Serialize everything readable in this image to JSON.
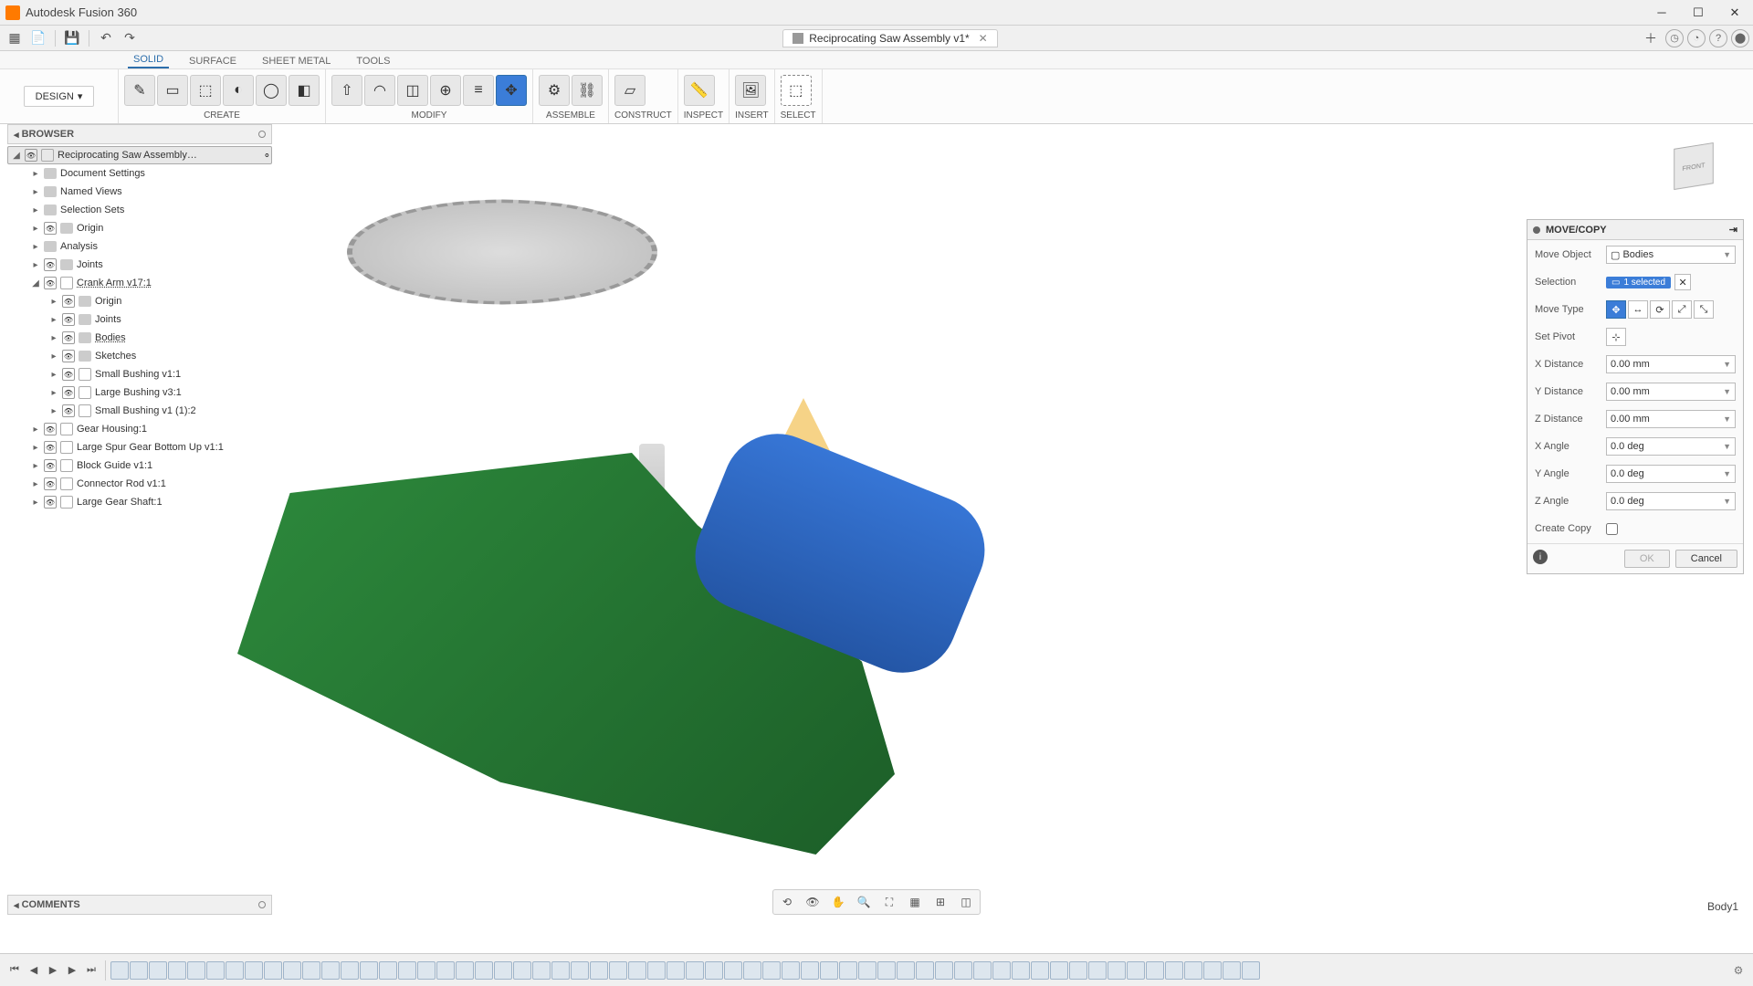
{
  "app": {
    "title": "Autodesk Fusion 360"
  },
  "doc": {
    "tab": "Reciprocating Saw Assembly v1*"
  },
  "workspace": {
    "label": "DESIGN"
  },
  "ribbontabs": [
    "SOLID",
    "SURFACE",
    "SHEET METAL",
    "TOOLS"
  ],
  "ribbon_active_tab": "SOLID",
  "ribbon_groups": [
    "CREATE",
    "MODIFY",
    "ASSEMBLE",
    "CONSTRUCT",
    "INSPECT",
    "INSERT",
    "SELECT"
  ],
  "browser": {
    "title": "BROWSER",
    "root": "Reciprocating Saw Assembly…",
    "items": [
      "Document Settings",
      "Named Views",
      "Selection Sets",
      "Origin",
      "Analysis",
      "Joints"
    ],
    "crank": {
      "name": "Crank Arm v17:1",
      "children": [
        "Origin",
        "Joints",
        "Bodies",
        "Sketches",
        "Small Bushing v1:1",
        "Large Bushing v3:1",
        "Small Bushing v1 (1):2"
      ]
    },
    "rest": [
      "Gear Housing:1",
      "Large Spur Gear Bottom Up v1:1",
      "Block Guide v1:1",
      "Connector Rod v1:1",
      "Large Gear Shaft:1"
    ]
  },
  "panel": {
    "title": "MOVE/COPY",
    "move_object_label": "Move Object",
    "move_object_value": "Bodies",
    "selection_label": "Selection",
    "selection_value": "1 selected",
    "move_type_label": "Move Type",
    "set_pivot_label": "Set Pivot",
    "x_dist_label": "X Distance",
    "x_dist": "0.00 mm",
    "y_dist_label": "Y Distance",
    "y_dist": "0.00 mm",
    "z_dist_label": "Z Distance",
    "z_dist": "0.00 mm",
    "x_ang_label": "X Angle",
    "x_ang": "0.0 deg",
    "y_ang_label": "Y Angle",
    "y_ang": "0.0 deg",
    "z_ang_label": "Z Angle",
    "z_ang": "0.0 deg",
    "create_copy_label": "Create Copy",
    "ok": "OK",
    "cancel": "Cancel"
  },
  "comments": {
    "title": "COMMENTS"
  },
  "status": {
    "hover": "Body1"
  },
  "viewcube": {
    "front": "FRONT"
  },
  "timeline_count": 60
}
